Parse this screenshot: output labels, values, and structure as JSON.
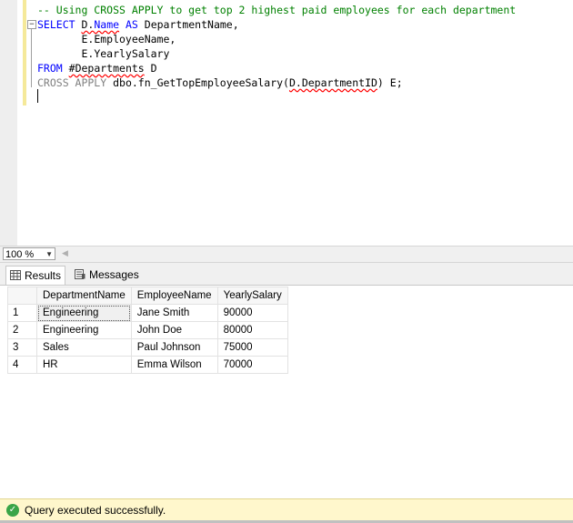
{
  "editor": {
    "lines": [
      "-- Using CROSS APPLY to get top 2 highest paid employees for each department",
      "SELECT D.Name AS DepartmentName,",
      "       E.EmployeeName,",
      "       E.YearlySalary",
      "FROM #Departments D",
      "CROSS APPLY dbo.fn_GetTopEmployeeSalary(D.DepartmentID) E;"
    ],
    "tokens": {
      "comment": "-- Using CROSS APPLY to get top 2 highest paid employees for each department",
      "select": "SELECT",
      "d_name_prefix": "D.",
      "name": "Name",
      "as": "AS",
      "dept_name": "DepartmentName,",
      "emp_name": "E.EmployeeName,",
      "yearly": "E.YearlySalary",
      "from": "FROM",
      "departments": "#Departments",
      "d_alias": "D",
      "cross_apply": "CROSS APPLY",
      "fn": "dbo.fn_GetTopEmployeeSalary(",
      "dept_id": "D.DepartmentID",
      "fn_end": ") E;"
    }
  },
  "zoom": {
    "value": "100 %"
  },
  "tabs": {
    "results": "Results",
    "messages": "Messages"
  },
  "grid": {
    "columns": [
      "DepartmentName",
      "EmployeeName",
      "YearlySalary"
    ],
    "rows": [
      {
        "num": "1",
        "cells": [
          "Engineering",
          "Jane Smith",
          "90000"
        ]
      },
      {
        "num": "2",
        "cells": [
          "Engineering",
          "John Doe",
          "80000"
        ]
      },
      {
        "num": "3",
        "cells": [
          "Sales",
          "Paul Johnson",
          "75000"
        ]
      },
      {
        "num": "4",
        "cells": [
          "HR",
          "Emma Wilson",
          "70000"
        ]
      }
    ]
  },
  "status": {
    "message": "Query executed successfully."
  },
  "colors": {
    "keyword": "#0000ff",
    "comment": "#008000",
    "status_bg": "#fff7cc",
    "success": "#3aa547"
  }
}
